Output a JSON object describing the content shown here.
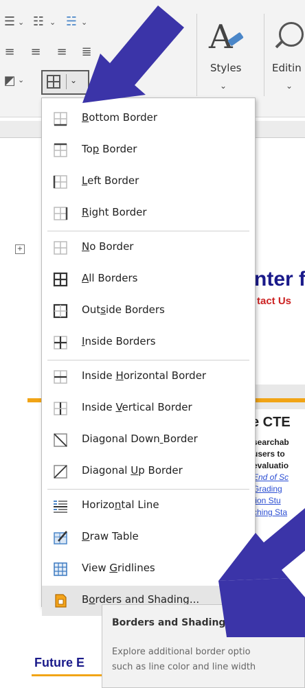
{
  "ribbon": {
    "styles_label": "Styles",
    "editing_label": "Editin"
  },
  "menu": {
    "items": [
      {
        "label": "Bottom Border",
        "icon": "bottom-border-icon"
      },
      {
        "label": "Top Border",
        "icon": "top-border-icon"
      },
      {
        "label": "Left Border",
        "icon": "left-border-icon"
      },
      {
        "label": "Right Border",
        "icon": "right-border-icon"
      },
      {
        "label": "No Border",
        "icon": "no-border-icon"
      },
      {
        "label": "All Borders",
        "icon": "all-borders-icon"
      },
      {
        "label": "Outside Borders",
        "icon": "outside-borders-icon"
      },
      {
        "label": "Inside Borders",
        "icon": "inside-borders-icon"
      },
      {
        "label": "Inside Horizontal Border",
        "icon": "inside-horizontal-border-icon"
      },
      {
        "label": "Inside Vertical Border",
        "icon": "inside-vertical-border-icon"
      },
      {
        "label": "Diagonal Down Border",
        "icon": "diagonal-down-border-icon"
      },
      {
        "label": "Diagonal Up Border",
        "icon": "diagonal-up-border-icon"
      },
      {
        "label": "Horizontal Line",
        "icon": "horizontal-line-icon"
      },
      {
        "label": "Draw Table",
        "icon": "draw-table-icon"
      },
      {
        "label": "View Gridlines",
        "icon": "view-gridlines-icon"
      },
      {
        "label": "Borders and Shading...",
        "icon": "borders-and-shading-icon"
      }
    ]
  },
  "tooltip": {
    "title": "Borders and Shading",
    "line1": "Explore additional border optio",
    "line2": "such as line color and line width"
  },
  "document": {
    "heading": "nter f",
    "subheading": "tact Us",
    "section": "e CTE",
    "lines": [
      {
        "text": "searchab",
        "style": "bold"
      },
      {
        "text": "users to",
        "style": "bold"
      },
      {
        "text": "evaluatio",
        "style": "bold"
      },
      {
        "text": "End of Sc",
        "style": "link"
      },
      {
        "text": "Grading",
        "style": "link2"
      },
      {
        "text": "tion Stu",
        "style": "link2"
      },
      {
        "text": "ching Sta",
        "style": "link2"
      }
    ],
    "footer_heading": "Future E"
  },
  "colors": {
    "arrow": "#3b34a8",
    "heading": "#1a1a8a",
    "accent_red": "#cc2222",
    "rule_orange": "#f1a416",
    "link_blue": "#2b4ed3"
  }
}
